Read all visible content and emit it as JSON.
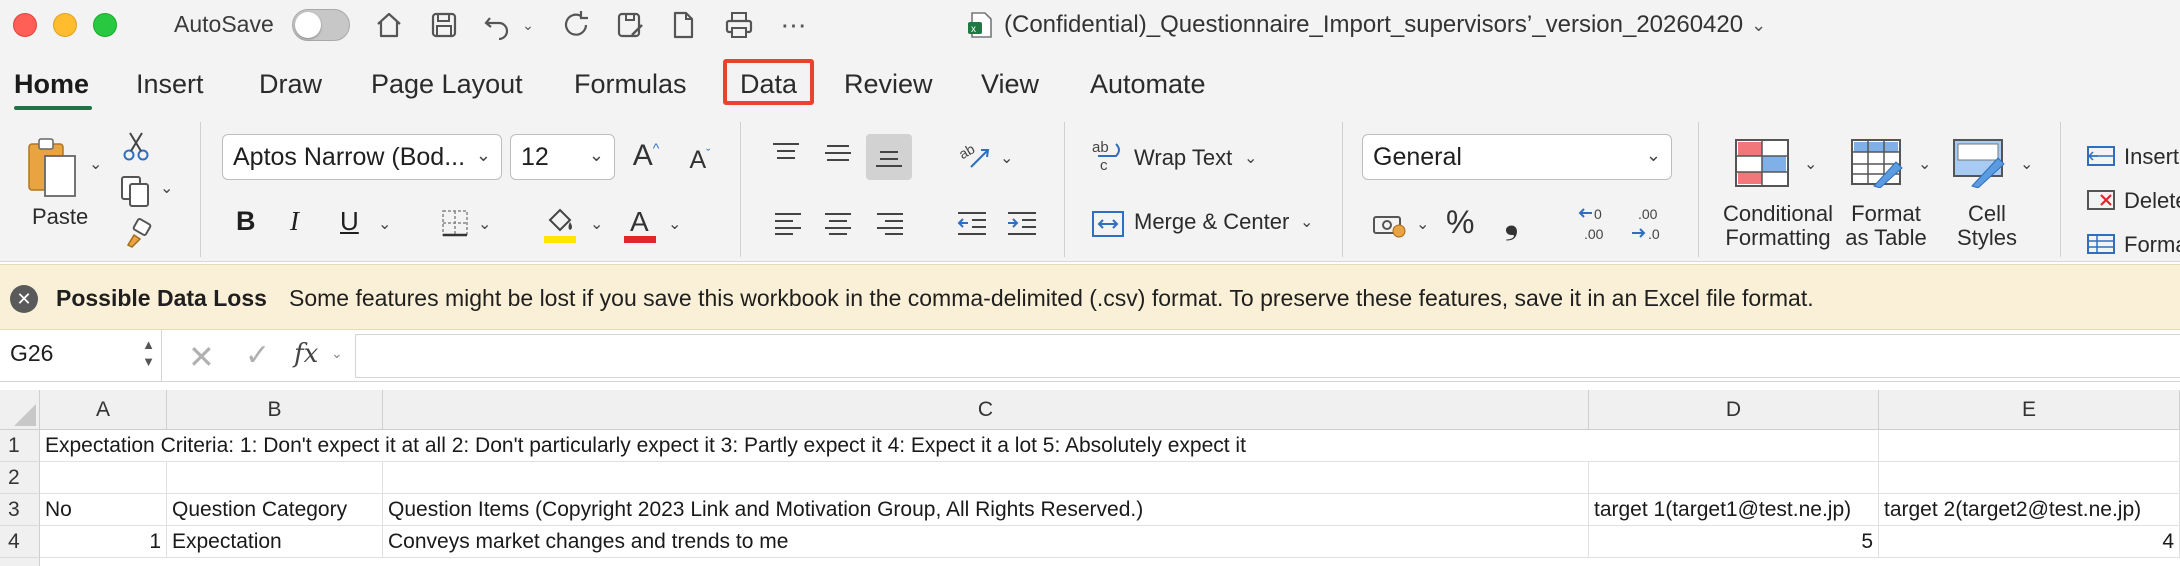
{
  "titlebar": {
    "autosave_label": "AutoSave",
    "autosave_state": "off",
    "quick_access_icons": [
      "home-icon",
      "save-icon",
      "undo-icon",
      "redo-icon",
      "refresh-icon",
      "save-as-icon",
      "new-document-icon",
      "print-icon",
      "more-icon"
    ],
    "document_title": "(Confidential)_Questionnaire_Import_supervisors’_version_20260420"
  },
  "tabs": [
    {
      "label": "Home",
      "active": true
    },
    {
      "label": "Insert",
      "active": false
    },
    {
      "label": "Draw",
      "active": false
    },
    {
      "label": "Page Layout",
      "active": false
    },
    {
      "label": "Formulas",
      "active": false
    },
    {
      "label": "Data",
      "active": false,
      "highlighted": true
    },
    {
      "label": "Review",
      "active": false
    },
    {
      "label": "View",
      "active": false
    },
    {
      "label": "Automate",
      "active": false
    }
  ],
  "ribbon": {
    "paste_label": "Paste",
    "font_name": "Aptos Narrow (Bod...",
    "font_size": "12",
    "bold": "B",
    "italic": "I",
    "underline": "U",
    "wrap_text_label": "Wrap Text",
    "merge_center_label": "Merge & Center",
    "number_format": "General",
    "percent": "%",
    "comma": "❟",
    "conditional_formatting_line1": "Conditional",
    "conditional_formatting_line2": "Formatting",
    "format_as_table_line1": "Format",
    "format_as_table_line2": "as Table",
    "cell_styles_line1": "Cell",
    "cell_styles_line2": "Styles",
    "insert_label": "Insert",
    "delete_label": "Delete",
    "format_label": "Format",
    "colors": {
      "accent_green": "#217346",
      "highlight_yellow": "#ffe600",
      "font_red": "#e0252b"
    }
  },
  "notification": {
    "title": "Possible Data Loss",
    "message": "Some features might be lost if you save this workbook in the comma-delimited (.csv) format. To preserve these features, save it in an Excel file format."
  },
  "formula_bar": {
    "name_box": "G26",
    "fx": "fx",
    "formula": ""
  },
  "sheet": {
    "columns": [
      "A",
      "B",
      "C",
      "D",
      "E"
    ],
    "rows": [
      {
        "num": "1",
        "A": "Expectation Criteria: 1: Don't expect it at all 2: Don't particularly expect it 3: Partly expect it 4: Expect it a lot 5: Absolutely expect it",
        "B": "",
        "C": "",
        "D": "",
        "E": ""
      },
      {
        "num": "2",
        "A": "",
        "B": "",
        "C": "",
        "D": "",
        "E": ""
      },
      {
        "num": "3",
        "A": "No",
        "B": "Question Category",
        "C": "Question Items (Copyright 2023 Link and Motivation Group, All Rights Reserved.)",
        "D": "target 1(target1@test.ne.jp)",
        "E": "target 2(target2@test.ne.jp)"
      },
      {
        "num": "4",
        "A": "1",
        "B": "Expectation",
        "C": "Conveys market changes and trends to me",
        "D": "5",
        "E": "4"
      }
    ]
  }
}
